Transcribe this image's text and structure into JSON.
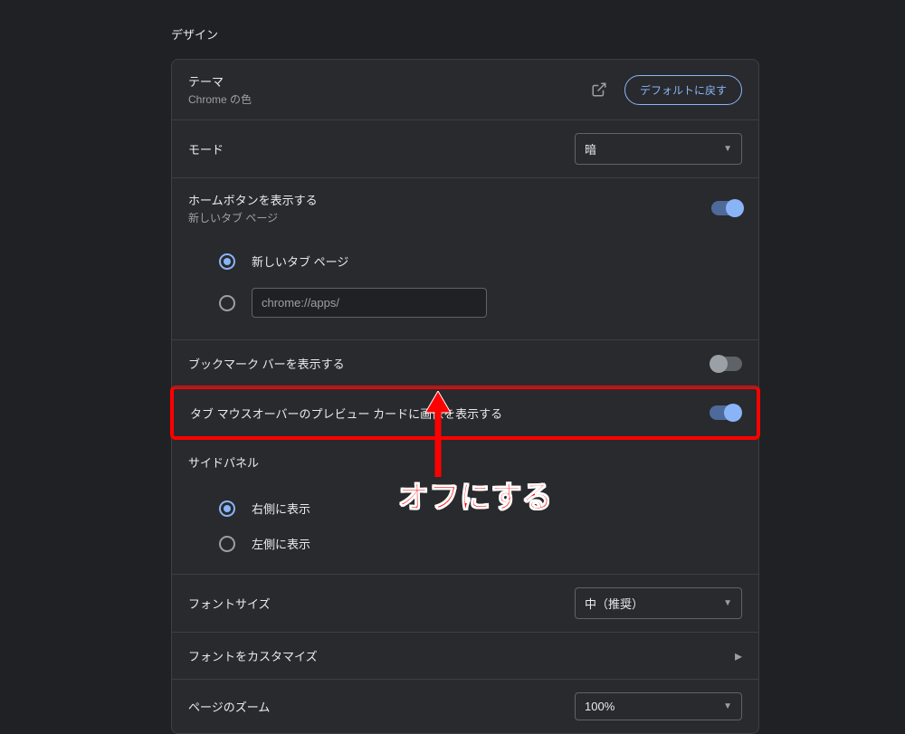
{
  "section_title": "デザイン",
  "theme": {
    "label": "テーマ",
    "sub": "Chrome の色",
    "open_icon": "open-in-new-icon",
    "reset_btn": "デフォルトに戻す"
  },
  "mode": {
    "label": "モード",
    "value": "暗"
  },
  "home_button": {
    "label": "ホームボタンを表示する",
    "sub": "新しいタブ ページ",
    "toggle": true,
    "radio_options": {
      "new_tab": "新しいタブ ページ",
      "url_value": "chrome://apps/"
    }
  },
  "bookmarks_bar": {
    "label": "ブックマーク バーを表示する",
    "toggle": false
  },
  "tab_hover_preview": {
    "label": "タブ マウスオーバーのプレビュー カードに画像を表示する",
    "toggle": true
  },
  "side_panel": {
    "label": "サイドパネル",
    "options": {
      "right": "右側に表示",
      "left": "左側に表示"
    }
  },
  "font_size": {
    "label": "フォントサイズ",
    "value": "中（推奨）"
  },
  "customize_fonts": {
    "label": "フォントをカスタマイズ"
  },
  "page_zoom": {
    "label": "ページのズーム",
    "value": "100%"
  },
  "annotation_text": "オフにする"
}
